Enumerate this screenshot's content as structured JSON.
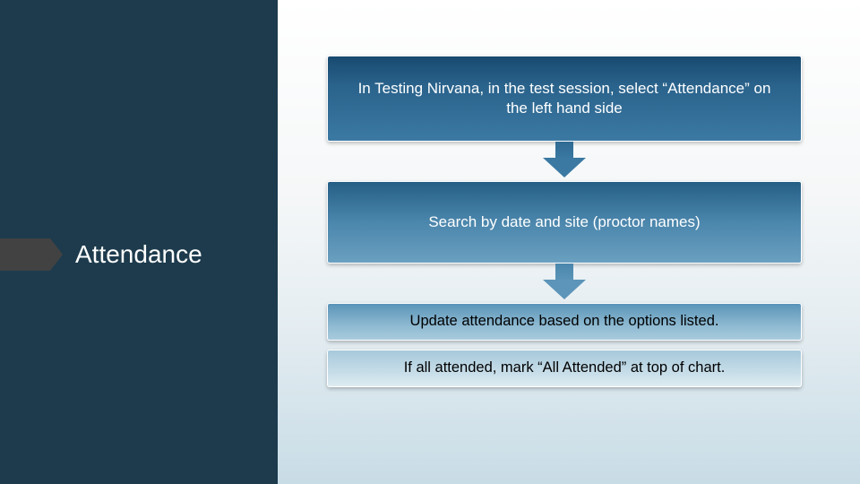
{
  "title": "Attendance",
  "steps": [
    {
      "text": "In Testing Nirvana, in the test session, select “Attendance” on the left hand side"
    },
    {
      "text": "Search by date and site (proctor names)"
    },
    {
      "text": "Update attendance based on the options listed."
    },
    {
      "text": "If all attended, mark “All Attended” at top of chart."
    }
  ]
}
